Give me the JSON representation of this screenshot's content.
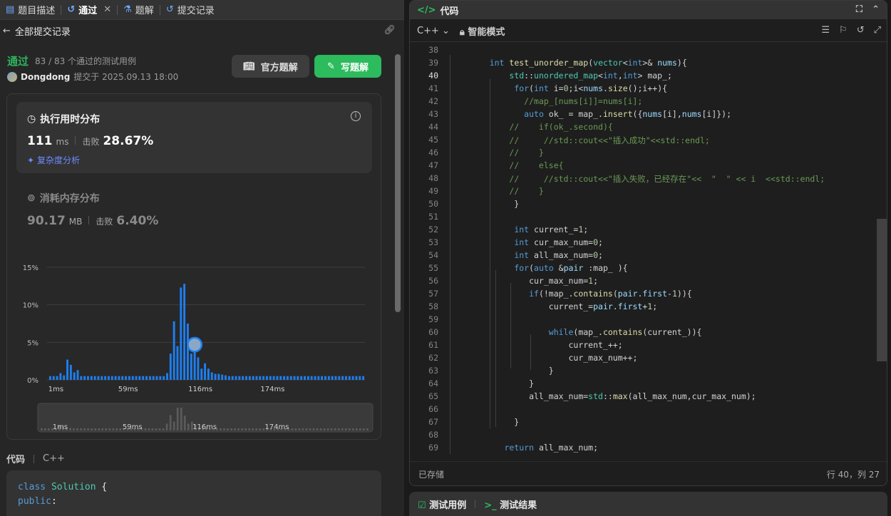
{
  "left_tabs": [
    {
      "label": "题目描述",
      "icon": "document-icon"
    },
    {
      "label": "通过",
      "icon": "history-icon",
      "active": true
    },
    {
      "label": "题解",
      "icon": "flask-icon"
    },
    {
      "label": "提交记录",
      "icon": "history-icon"
    }
  ],
  "nav": {
    "back_label": "全部提交记录"
  },
  "submission": {
    "status": "通过",
    "passed": "83 / 83 个通过的测试用例",
    "user": "Dongdong",
    "submitted_at": "提交于 2025.09.13 18:00",
    "btn_official": "官方题解",
    "btn_write": "写题解"
  },
  "runtime": {
    "title": "执行用时分布",
    "value": "111",
    "unit": "ms",
    "beat_label": "击败",
    "beat": "28.67%",
    "complexity_link": "复杂度分析"
  },
  "memory": {
    "title": "消耗内存分布",
    "value": "90.17",
    "unit": "MB",
    "beat_label": "击败",
    "beat": "6.40%"
  },
  "chart_data": {
    "type": "bar",
    "ylabel_ticks": [
      "15%",
      "10%",
      "5%",
      "0%"
    ],
    "ylim": [
      0,
      15
    ],
    "x_tick_labels": [
      "1ms",
      "59ms",
      "116ms",
      "174ms"
    ],
    "highlight_bin_index": 42,
    "values": [
      0.5,
      0.5,
      0.5,
      0.9,
      0.6,
      2.7,
      2,
      1,
      1.3,
      0.5,
      0.5,
      0.5,
      0.5,
      0.5,
      0.5,
      0.5,
      0.5,
      0.5,
      0.5,
      0.5,
      0.5,
      0.5,
      0.5,
      0.5,
      0.5,
      0.5,
      0.5,
      0.5,
      0.5,
      0.5,
      0.5,
      0.5,
      0.5,
      0.5,
      0.9,
      3.5,
      7.8,
      4.5,
      12.3,
      12.8,
      7.5,
      3.5,
      4.5,
      3,
      1.5,
      2.2,
      1.5,
      1,
      0.8,
      0.8,
      0.7,
      0.6,
      0.5,
      0.5,
      0.5,
      0.5,
      0.5,
      0.5,
      0.5,
      0.5,
      0.5,
      0.5,
      0.5,
      0.5,
      0.5,
      0.5,
      0.5,
      0.5,
      0.5,
      0.5,
      0.5,
      0.5,
      0.5,
      0.5,
      0.5,
      0.5,
      0.5,
      0.5,
      0.5,
      0.5,
      0.5,
      0.5,
      0.5,
      0.5,
      0.5,
      0.5,
      0.5,
      0.5,
      0.5,
      0.5,
      0.5,
      0.5
    ]
  },
  "code_section": {
    "label": "代码",
    "lang": "C++",
    "lines": [
      "class Solution {",
      "public:"
    ]
  },
  "right_header": {
    "title": "代码",
    "lang": "C++",
    "mode": "智能模式"
  },
  "editor": {
    "start_line": 38,
    "current_line": 40,
    "lines": [
      "",
      "    int test_unorder_map(vector<int>& nums){",
      "        std::unordered_map<int,int> map_;",
      "         for(int i=0;i<nums.size();i++){",
      "           //map_[nums[i]]=nums[i];",
      "           auto ok_ = map_.insert({nums[i],nums[i]});",
      "        //    if(ok_.second){",
      "        //     //std::cout<<\"插入成功\"<<std::endl;",
      "        //    }",
      "        //    else{",
      "        //     //std::cout<<\"插入失败，已经存在\"<<  \"  \" << i  <<std::endl;",
      "        //    }",
      "         }",
      "",
      "         int current_=1;",
      "         int cur_max_num=0;",
      "         int all_max_num=0;",
      "         for(auto &pair :map_ ){",
      "            cur_max_num=1;",
      "            if(!map_.contains(pair.first-1)){",
      "                current_=pair.first+1;",
      "",
      "                while(map_.contains(current_)){",
      "                    current_++;",
      "                    cur_max_num++;",
      "                }",
      "            }",
      "            all_max_num=std::max(all_max_num,cur_max_num);",
      "",
      "         }",
      "",
      "       return all_max_num;"
    ]
  },
  "footer": {
    "saved": "已存储",
    "position": "行 40，列 27"
  },
  "bottom_tabs": {
    "testcase": "测试用例",
    "result": "测试结果"
  },
  "colors": {
    "accent_green": "#2cbb5d",
    "bar_blue": "#1e7ff0",
    "link_blue": "#6e8bff"
  }
}
